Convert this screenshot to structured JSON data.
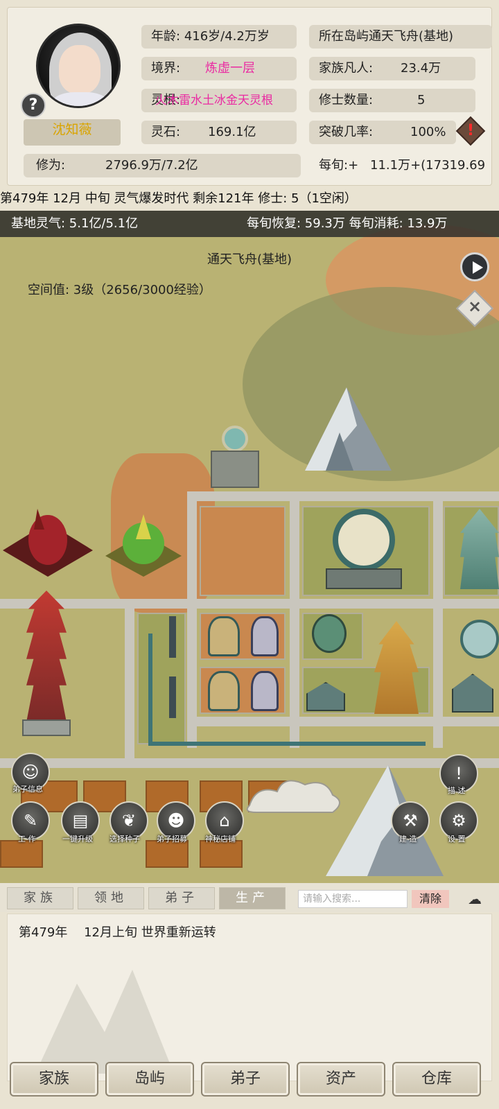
{
  "character": {
    "name": "沈知薇",
    "help_icon": "?"
  },
  "stats": {
    "age_label": "年龄:",
    "age_value": "416岁/4.2万岁",
    "island_label": "所在岛屿",
    "island_value": "通天飞舟(基地)",
    "realm_label": "境界:",
    "realm_value": "炼虚一层",
    "family_label": "家族凡人:",
    "family_value": "23.4万",
    "root_label": "灵根:",
    "root_value": "火木雷水土冰金天灵根",
    "cultivators_label": "修士数量:",
    "cultivators_value": "5",
    "stones_label": "灵石:",
    "stones_value": "169.1亿",
    "breakthrough_label": "突破几率:",
    "breakthrough_value": "100%",
    "cultivation_label": "修为:",
    "cultivation_value": "2796.9万/7.2亿",
    "per_period_label": "每旬:+",
    "per_period_value": "11.1万+(17319.69"
  },
  "time_line": "第479年 12月 中旬  灵气爆发时代 剩余121年  修士: 5（1空闲）",
  "map": {
    "base_qi": "基地灵气: 5.1亿/5.1亿",
    "recovery": "每旬恢复: 59.3万 每旬消耗: 13.9万",
    "title": "通天飞舟(基地)",
    "space_value": "空间值: 3级（2656/3000经验）"
  },
  "actions": {
    "disciple_info": "弟子信息",
    "work": "工 作",
    "upgrade": "一键升级",
    "select_seed": "选择种子",
    "recruit": "弟子招募",
    "shop": "神秘店铺",
    "describe": "描 述",
    "build": "建 造",
    "settings": "设 置"
  },
  "tabs": [
    "家族",
    "领地",
    "弟子",
    "生产"
  ],
  "search": {
    "placeholder": "请输入搜索...",
    "clear_label": "清除"
  },
  "log": {
    "year": "第479年",
    "text": "12月上旬 世界重新运转"
  },
  "bottom_nav": [
    "家族",
    "岛屿",
    "弟子",
    "资产",
    "仓库"
  ],
  "colors": {
    "realm": "#ea2aa2",
    "name": "#d9a400",
    "map_ground": "#b9b273"
  }
}
